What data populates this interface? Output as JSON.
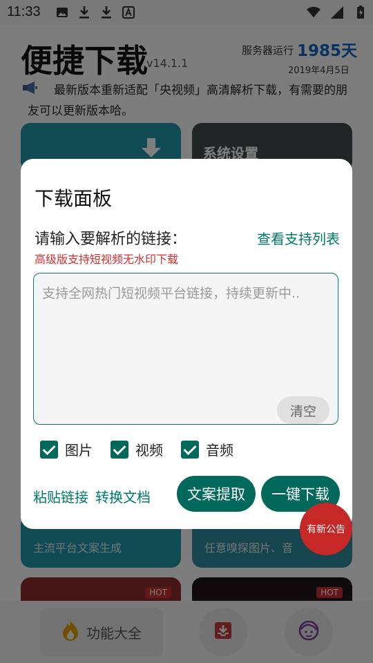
{
  "status_bar": {
    "time": "11:33"
  },
  "app": {
    "title": "便捷下载",
    "version": "v14.1.1",
    "server_label": "服务器运行",
    "server_days": "1985天",
    "server_date": "2019年4月5日",
    "notice": "最新版本重新适配「央视频」高清解析下载，有需要的朋友可以更新版本哈。"
  },
  "cards": {
    "settings_label": "系统设置",
    "copy_sub": "主流平台文案生成",
    "sniff_sub": "任意嗅探图片、音",
    "hot_badge": "HOT"
  },
  "fab": {
    "label": "有新公告"
  },
  "bottom_nav": {
    "main_label": "功能大全"
  },
  "dialog": {
    "title": "下载面板",
    "prompt": "请输入要解析的链接：",
    "support_link": "查看支持列表",
    "premium_note": "高级版支持短视频无水印下载",
    "input_placeholder": "支持全网热门短视频平台链接，持续更新中..",
    "input_value": "",
    "clear_label": "清空",
    "checkboxes": [
      {
        "label": "图片",
        "checked": true
      },
      {
        "label": "视频",
        "checked": true
      },
      {
        "label": "音频",
        "checked": true
      }
    ],
    "paste_label": "粘贴链接",
    "convert_label": "转换文档",
    "extract_label": "文案提取",
    "download_label": "一键下载"
  },
  "colors": {
    "accent": "#00695c",
    "link": "#00796b",
    "warning": "#d32f2f",
    "server_days": "#1565c0",
    "fab": "#c62828"
  }
}
